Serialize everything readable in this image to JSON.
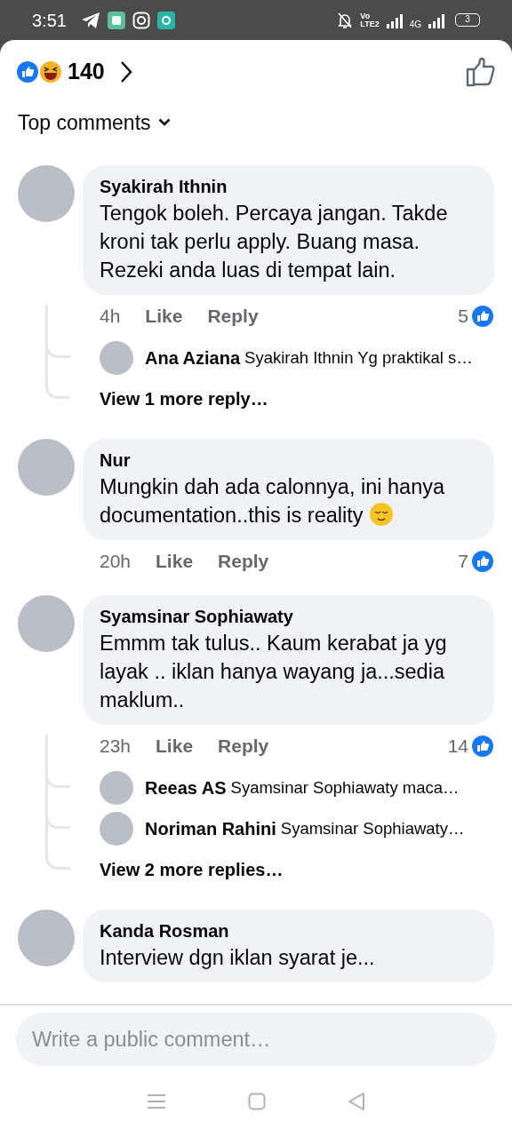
{
  "status_bar": {
    "time": "3:51",
    "volte": "Vo",
    "volte_sub": "LTE2",
    "network": "4G",
    "battery": "3"
  },
  "reactions": {
    "count": "140"
  },
  "sort": {
    "label": "Top comments"
  },
  "comments": [
    {
      "author": "Syakirah Ithnin",
      "text": "Tengok boleh. Percaya jangan. Takde kroni tak perlu apply. Buang masa. Rezeki anda luas di tempat lain.",
      "has_emoji": false,
      "time": "4h",
      "like": "Like",
      "reply": "Reply",
      "likes": "5",
      "replies": [
        {
          "author": "Ana Aziana",
          "text": "Syakirah Ithnin Yg praktikal s…"
        }
      ],
      "view_more": "View 1 more reply…"
    },
    {
      "author": "Nur",
      "text": "Mungkin dah ada calonnya, ini hanya documentation..this is reality",
      "has_emoji": true,
      "time": "20h",
      "like": "Like",
      "reply": "Reply",
      "likes": "7"
    },
    {
      "author": "Syamsinar Sophiawaty",
      "text": "Emmm tak tulus.. Kaum kerabat ja yg layak .. iklan hanya wayang ja...sedia maklum..",
      "has_emoji": false,
      "time": "23h",
      "like": "Like",
      "reply": "Reply",
      "likes": "14",
      "replies": [
        {
          "author": "Reeas AS",
          "text": "Syamsinar Sophiawaty maca…"
        },
        {
          "author": "Noriman Rahini",
          "text": "Syamsinar Sophiawaty…"
        }
      ],
      "view_more": "View 2 more replies…"
    },
    {
      "author": "Kanda Rosman",
      "text": "Interview dgn iklan syarat je...",
      "has_emoji": false
    }
  ],
  "composer": {
    "placeholder": "Write a public comment…"
  }
}
